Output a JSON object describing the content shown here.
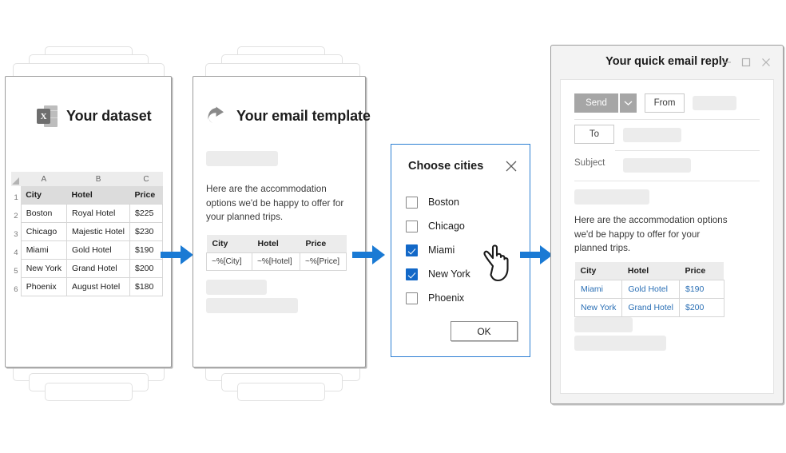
{
  "accent_blue": "#1a7ad4",
  "checkbox_blue": "#1268c8",
  "link_blue": "#2a6fb5",
  "panels": {
    "dataset": {
      "title": "Your dataset",
      "icon": "excel-icon",
      "icon_glyph": "X",
      "sheet": {
        "column_letters": [
          "A",
          "B",
          "C"
        ],
        "row_numbers": [
          "1",
          "2",
          "3",
          "4",
          "5",
          "6"
        ],
        "headers": [
          "City",
          "Hotel",
          "Price"
        ],
        "rows": [
          [
            "Boston",
            "Royal Hotel",
            "$225"
          ],
          [
            "Chicago",
            "Majestic Hotel",
            "$230"
          ],
          [
            "Miami",
            "Gold Hotel",
            "$190"
          ],
          [
            "New York",
            "Grand Hotel",
            "$200"
          ],
          [
            "Phoenix",
            "August Hotel",
            "$180"
          ]
        ]
      }
    },
    "template": {
      "title": "Your email template",
      "icon": "reply-arrow-icon",
      "body_text": "Here are the accommodation options we'd be happy to offer for your planned trips.",
      "table": {
        "headers": [
          "City",
          "Hotel",
          "Price"
        ],
        "row": [
          "~%[City]",
          "~%[Hotel]",
          "~%[Price]"
        ]
      }
    }
  },
  "dialog": {
    "title": "Choose cities",
    "close_icon": "close-icon",
    "options": [
      {
        "label": "Boston",
        "checked": false
      },
      {
        "label": "Chicago",
        "checked": false
      },
      {
        "label": "Miami",
        "checked": true
      },
      {
        "label": "New York",
        "checked": true
      },
      {
        "label": "Phoenix",
        "checked": false
      }
    ],
    "ok_label": "OK"
  },
  "cursor": {
    "icon": "pointing-hand-cursor"
  },
  "reply_window": {
    "title": "Your quick email reply",
    "window_controls": {
      "minimize": "minimize-icon",
      "maximize": "maximize-icon",
      "close": "close-icon"
    },
    "send_label": "Send",
    "send_caret_icon": "chevron-down-icon",
    "from_label": "From",
    "to_label": "To",
    "subject_label": "Subject",
    "body_text": "Here are the accommodation options we'd be happy to offer for your planned trips.",
    "table": {
      "headers": [
        "City",
        "Hotel",
        "Price"
      ],
      "rows": [
        [
          "Miami",
          "Gold Hotel",
          "$190"
        ],
        [
          "New York",
          "Grand Hotel",
          "$200"
        ]
      ]
    }
  },
  "arrows": [
    {
      "name": "arrow-dataset-to-template"
    },
    {
      "name": "arrow-template-to-dialog"
    },
    {
      "name": "arrow-dialog-to-reply"
    }
  ]
}
